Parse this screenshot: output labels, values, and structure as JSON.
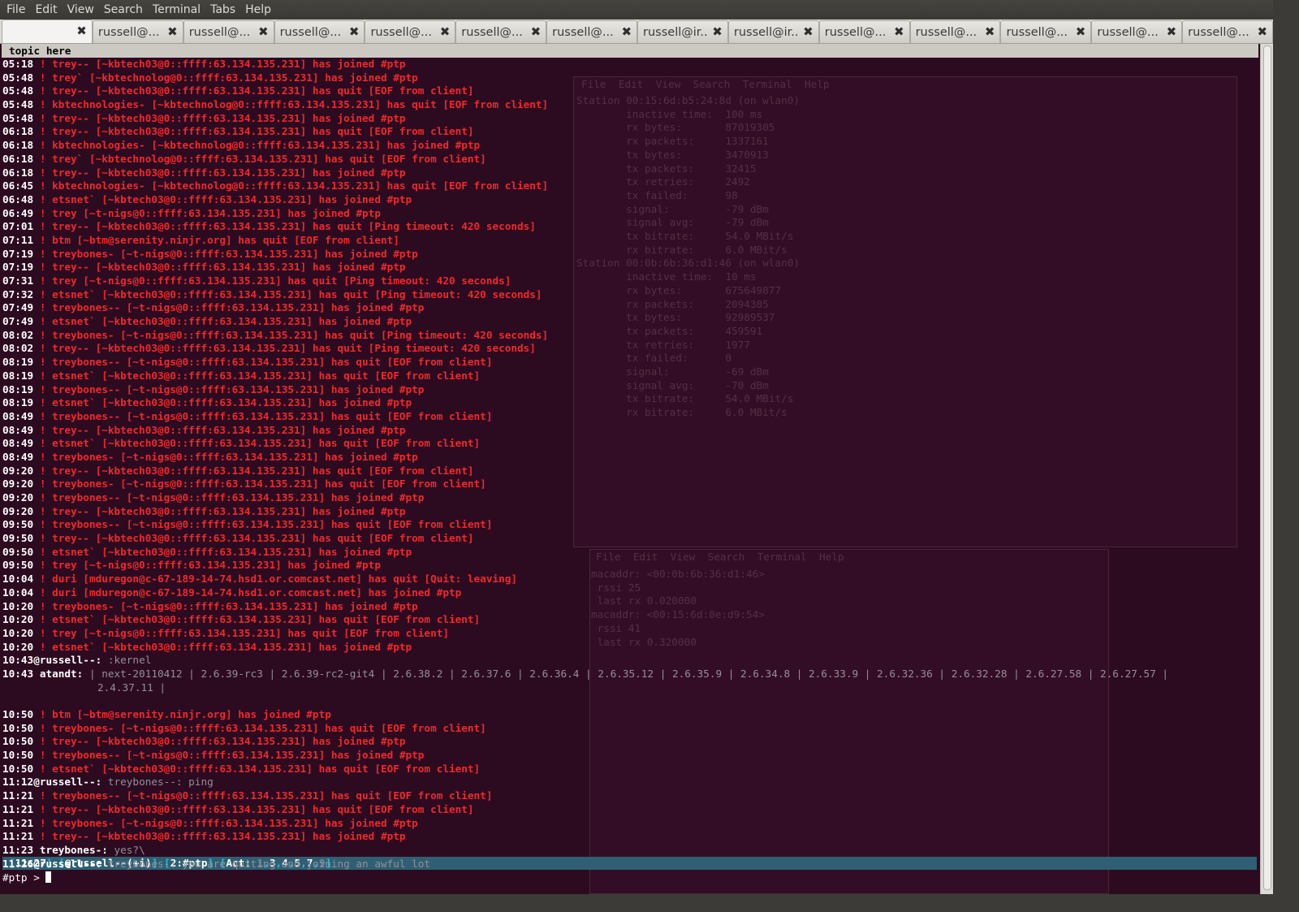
{
  "menu": [
    "File",
    "Edit",
    "View",
    "Search",
    "Terminal",
    "Tabs",
    "Help"
  ],
  "tabs": [
    {
      "label": "",
      "active": true
    },
    {
      "label": "russell@...",
      "active": false
    },
    {
      "label": "russell@...",
      "active": false
    },
    {
      "label": "russell@...",
      "active": false
    },
    {
      "label": "russell@...",
      "active": false
    },
    {
      "label": "russell@...",
      "active": false
    },
    {
      "label": "russell@...",
      "active": false
    },
    {
      "label": "russell@ir...",
      "active": false
    },
    {
      "label": "russell@ir...",
      "active": false
    },
    {
      "label": "russell@...",
      "active": false
    },
    {
      "label": "russell@...",
      "active": false
    },
    {
      "label": "russell@...",
      "active": false
    },
    {
      "label": "russell@...",
      "active": false
    },
    {
      "label": "russell@...",
      "active": false
    }
  ],
  "close_glyph": "✖",
  "topic": "topic here",
  "log": [
    {
      "t": "05:18",
      "type": "event",
      "text": " ! trey-- [~kbtech03@0::ffff:63.134.135.231] has joined #ptp"
    },
    {
      "t": "05:48",
      "type": "event",
      "text": " ! trey` [~kbtechnolog@0::ffff:63.134.135.231] has joined #ptp"
    },
    {
      "t": "05:48",
      "type": "event",
      "text": " ! trey-- [~kbtech03@0::ffff:63.134.135.231] has quit [EOF from client]"
    },
    {
      "t": "05:48",
      "type": "event",
      "text": " ! kbtechnologies- [~kbtechnolog@0::ffff:63.134.135.231] has quit [EOF from client]"
    },
    {
      "t": "05:48",
      "type": "event",
      "text": " ! trey-- [~kbtech03@0::ffff:63.134.135.231] has joined #ptp"
    },
    {
      "t": "06:18",
      "type": "event",
      "text": " ! trey-- [~kbtech03@0::ffff:63.134.135.231] has quit [EOF from client]"
    },
    {
      "t": "06:18",
      "type": "event",
      "text": " ! kbtechnologies- [~kbtechnolog@0::ffff:63.134.135.231] has joined #ptp"
    },
    {
      "t": "06:18",
      "type": "event",
      "text": " ! trey` [~kbtechnolog@0::ffff:63.134.135.231] has quit [EOF from client]"
    },
    {
      "t": "06:18",
      "type": "event",
      "text": " ! trey-- [~kbtech03@0::ffff:63.134.135.231] has joined #ptp"
    },
    {
      "t": "06:45",
      "type": "event",
      "text": " ! kbtechnologies- [~kbtechnolog@0::ffff:63.134.135.231] has quit [EOF from client]"
    },
    {
      "t": "06:48",
      "type": "event",
      "text": " ! etsnet` [~kbtech03@0::ffff:63.134.135.231] has joined #ptp"
    },
    {
      "t": "06:49",
      "type": "event",
      "text": " ! trey [~t-nigs@0::ffff:63.134.135.231] has joined #ptp"
    },
    {
      "t": "07:01",
      "type": "event",
      "text": " ! trey-- [~kbtech03@0::ffff:63.134.135.231] has quit [Ping timeout: 420 seconds]"
    },
    {
      "t": "07:11",
      "type": "event",
      "text": " ! btm [~btm@serenity.ninjr.org] has quit [EOF from client]"
    },
    {
      "t": "07:19",
      "type": "event",
      "text": " ! treybones- [~t-nigs@0::ffff:63.134.135.231] has joined #ptp"
    },
    {
      "t": "07:19",
      "type": "event",
      "text": " ! trey-- [~kbtech03@0::ffff:63.134.135.231] has joined #ptp"
    },
    {
      "t": "07:31",
      "type": "event",
      "text": " ! trey [~t-nigs@0::ffff:63.134.135.231] has quit [Ping timeout: 420 seconds]"
    },
    {
      "t": "07:32",
      "type": "event",
      "text": " ! etsnet` [~kbtech03@0::ffff:63.134.135.231] has quit [Ping timeout: 420 seconds]"
    },
    {
      "t": "07:49",
      "type": "event",
      "text": " ! treybones-- [~t-nigs@0::ffff:63.134.135.231] has joined #ptp"
    },
    {
      "t": "07:49",
      "type": "event",
      "text": " ! etsnet` [~kbtech03@0::ffff:63.134.135.231] has joined #ptp"
    },
    {
      "t": "08:02",
      "type": "event",
      "text": " ! treybones- [~t-nigs@0::ffff:63.134.135.231] has quit [Ping timeout: 420 seconds]"
    },
    {
      "t": "08:02",
      "type": "event",
      "text": " ! trey-- [~kbtech03@0::ffff:63.134.135.231] has quit [Ping timeout: 420 seconds]"
    },
    {
      "t": "08:19",
      "type": "event",
      "text": " ! treybones-- [~t-nigs@0::ffff:63.134.135.231] has quit [EOF from client]"
    },
    {
      "t": "08:19",
      "type": "event",
      "text": " ! etsnet` [~kbtech03@0::ffff:63.134.135.231] has quit [EOF from client]"
    },
    {
      "t": "08:19",
      "type": "event",
      "text": " ! treybones-- [~t-nigs@0::ffff:63.134.135.231] has joined #ptp"
    },
    {
      "t": "08:19",
      "type": "event",
      "text": " ! etsnet` [~kbtech03@0::ffff:63.134.135.231] has joined #ptp"
    },
    {
      "t": "08:49",
      "type": "event",
      "text": " ! treybones-- [~t-nigs@0::ffff:63.134.135.231] has quit [EOF from client]"
    },
    {
      "t": "08:49",
      "type": "event",
      "text": " ! trey-- [~kbtech03@0::ffff:63.134.135.231] has joined #ptp"
    },
    {
      "t": "08:49",
      "type": "event",
      "text": " ! etsnet` [~kbtech03@0::ffff:63.134.135.231] has quit [EOF from client]"
    },
    {
      "t": "08:49",
      "type": "event",
      "text": " ! treybones- [~t-nigs@0::ffff:63.134.135.231] has joined #ptp"
    },
    {
      "t": "09:20",
      "type": "event",
      "text": " ! trey-- [~kbtech03@0::ffff:63.134.135.231] has quit [EOF from client]"
    },
    {
      "t": "09:20",
      "type": "event",
      "text": " ! treybones- [~t-nigs@0::ffff:63.134.135.231] has quit [EOF from client]"
    },
    {
      "t": "09:20",
      "type": "event",
      "text": " ! treybones-- [~t-nigs@0::ffff:63.134.135.231] has joined #ptp"
    },
    {
      "t": "09:20",
      "type": "event",
      "text": " ! trey-- [~kbtech03@0::ffff:63.134.135.231] has joined #ptp"
    },
    {
      "t": "09:50",
      "type": "event",
      "text": " ! treybones-- [~t-nigs@0::ffff:63.134.135.231] has quit [EOF from client]"
    },
    {
      "t": "09:50",
      "type": "event",
      "text": " ! trey-- [~kbtech03@0::ffff:63.134.135.231] has quit [EOF from client]"
    },
    {
      "t": "09:50",
      "type": "event",
      "text": " ! etsnet` [~kbtech03@0::ffff:63.134.135.231] has joined #ptp"
    },
    {
      "t": "09:50",
      "type": "event",
      "text": " ! trey [~t-nigs@0::ffff:63.134.135.231] has joined #ptp"
    },
    {
      "t": "10:04",
      "type": "event",
      "text": " ! duri [mduregon@c-67-189-14-74.hsd1.or.comcast.net] has quit [Quit: leaving]"
    },
    {
      "t": "10:04",
      "type": "event",
      "text": " ! duri [mduregon@c-67-189-14-74.hsd1.or.comcast.net] has joined #ptp"
    },
    {
      "t": "10:20",
      "type": "event",
      "text": " ! treybones- [~t-nigs@0::ffff:63.134.135.231] has joined #ptp"
    },
    {
      "t": "10:20",
      "type": "event",
      "text": " ! etsnet` [~kbtech03@0::ffff:63.134.135.231] has quit [EOF from client]"
    },
    {
      "t": "10:20",
      "type": "event",
      "text": " ! trey [~t-nigs@0::ffff:63.134.135.231] has quit [EOF from client]"
    },
    {
      "t": "10:20",
      "type": "event",
      "text": " ! etsnet` [~kbtech03@0::ffff:63.134.135.231] has joined #ptp"
    },
    {
      "t": "10:43",
      "type": "msg",
      "nick": "@russell--:",
      "text": " :kernel"
    },
    {
      "t": "10:43",
      "type": "msg",
      "nick": " atandt:",
      "text": " | next-20110412 | 2.6.39-rc3 | 2.6.39-rc2-git4 | 2.6.38.2 | 2.6.37.6 | 2.6.36.4 | 2.6.35.12 | 2.6.35.9 | 2.6.34.8 | 2.6.33.9 | 2.6.32.36 | 2.6.32.28 | 2.6.27.58 | 2.6.27.57 |"
    },
    {
      "t": "",
      "type": "cont",
      "text": "2.4.37.11 |"
    },
    {
      "t": "",
      "type": "blank",
      "text": ""
    },
    {
      "t": "10:50",
      "type": "event",
      "text": " ! btm [~btm@serenity.ninjr.org] has joined #ptp"
    },
    {
      "t": "10:50",
      "type": "event",
      "text": " ! treybones- [~t-nigs@0::ffff:63.134.135.231] has quit [EOF from client]"
    },
    {
      "t": "10:50",
      "type": "event",
      "text": " ! trey-- [~kbtech03@0::ffff:63.134.135.231] has joined #ptp"
    },
    {
      "t": "10:50",
      "type": "event",
      "text": " ! treybones-- [~t-nigs@0::ffff:63.134.135.231] has joined #ptp"
    },
    {
      "t": "10:50",
      "type": "event",
      "text": " ! etsnet` [~kbtech03@0::ffff:63.134.135.231] has quit [EOF from client]"
    },
    {
      "t": "11:12",
      "type": "msg",
      "nick": "@russell--:",
      "text": " treybones--: ping"
    },
    {
      "t": "11:21",
      "type": "event",
      "text": " ! treybones-- [~t-nigs@0::ffff:63.134.135.231] has quit [EOF from client]"
    },
    {
      "t": "11:21",
      "type": "event",
      "text": " ! trey-- [~kbtech03@0::ffff:63.134.135.231] has quit [EOF from client]"
    },
    {
      "t": "11:21",
      "type": "event",
      "text": " ! treybones- [~t-nigs@0::ffff:63.134.135.231] has joined #ptp"
    },
    {
      "t": "11:21",
      "type": "event",
      "text": " ! trey-- [~kbtech03@0::ffff:63.134.135.231] has joined #ptp"
    },
    {
      "t": "11:23",
      "type": "msg",
      "nick": " treybones-:",
      "text": " yes?\\"
    },
    {
      "t": "11:26",
      "type": "msg",
      "nick": "@russell--:",
      "text": " treybones-: you are quiting and joining an awful lot"
    }
  ],
  "status": {
    "time": "11:27",
    "nick": "@russell--(+i)",
    "window": "2:#ptp",
    "act_label": "Act:",
    "act_items": [
      {
        "n": "1",
        "dim": true
      },
      {
        "n": "3",
        "dim": false
      },
      {
        "n": "4",
        "dim": false
      },
      {
        "n": "5",
        "dim": false
      },
      {
        "n": "7",
        "dim": false
      },
      {
        "n": "9",
        "dim": true
      }
    ]
  },
  "prompt": "#ptp > ",
  "ghost": {
    "menu": "File  Edit  View  Search  Terminal  Help",
    "lines_top": [
      "Station 00:15:6d:b5:24:8d (on wlan0)",
      "        inactive time:  100 ms",
      "        rx bytes:       87019305",
      "        rx packets:     1337161",
      "        tx bytes:       3470913",
      "        tx packets:     32415",
      "        tx retries:     2492",
      "        tx failed:      98",
      "        signal:         -79 dBm",
      "        signal avg:     -79 dBm",
      "        tx bitrate:     54.0 MBit/s",
      "        rx bitrate:     6.0 MBit/s",
      "Station 00:0b:6b:36:d1:46 (on wlan0)",
      "        inactive time:  10 ms",
      "        rx bytes:       675649877",
      "        rx packets:     2094305",
      "        tx bytes:       92989537",
      "        tx packets:     459591",
      "        tx retries:     1977",
      "        tx failed:      0",
      "        signal:         -69 dBm",
      "        signal avg:     -70 dBm",
      "        tx bitrate:     54.0 MBit/s",
      "        rx bitrate:     6.0 MBit/s"
    ],
    "lines_bottom": [
      "macaddr: <00:0b:6b:36:d1:46>",
      " rssi 25",
      " last rx 0.020000",
      "macaddr: <00:15:6d:8e:d9:54>",
      " rssi 41",
      " last rx 0.320000"
    ]
  },
  "colors": {
    "terminal_bg": "#2c0b21",
    "event_red": "#ef2929",
    "status_bg": "#2f5f72"
  }
}
